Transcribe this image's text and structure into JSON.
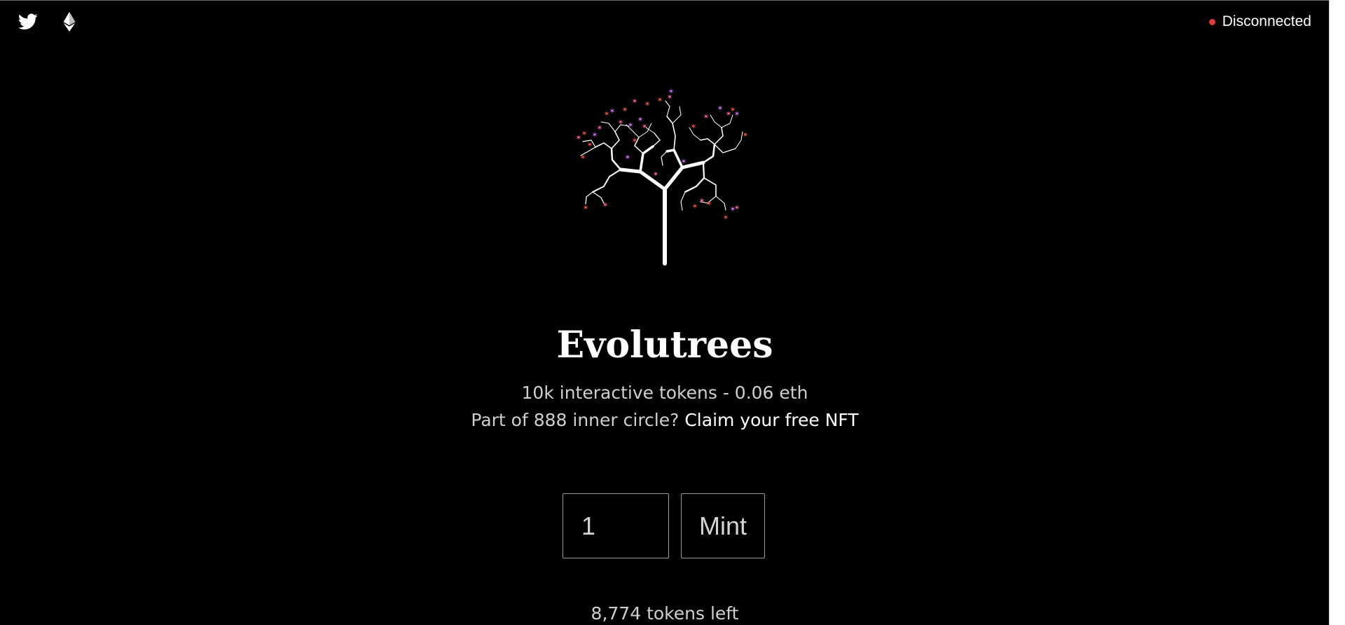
{
  "header": {
    "twitter_icon": "twitter-icon",
    "ethereum_icon": "ethereum-icon",
    "status": {
      "label": "Disconnected",
      "dot_color": "#e03b3b"
    }
  },
  "hero": {
    "image": "tree-illustration",
    "title": "Evolutrees",
    "tagline": "10k interactive tokens - 0.06 eth",
    "claim_prefix": "Part of 888 inner circle? ",
    "claim_link": "Claim your free NFT"
  },
  "mint": {
    "quantity_value": "1",
    "button_label": "Mint"
  },
  "supply": {
    "tokens_left": "8,774 tokens left"
  },
  "colors": {
    "background": "#000000",
    "text": "#cfcfcf",
    "accent_white": "#ffffff",
    "blossom_pink": "#f0609a",
    "blossom_red": "#e8504a",
    "blossom_violet": "#c870f0"
  }
}
